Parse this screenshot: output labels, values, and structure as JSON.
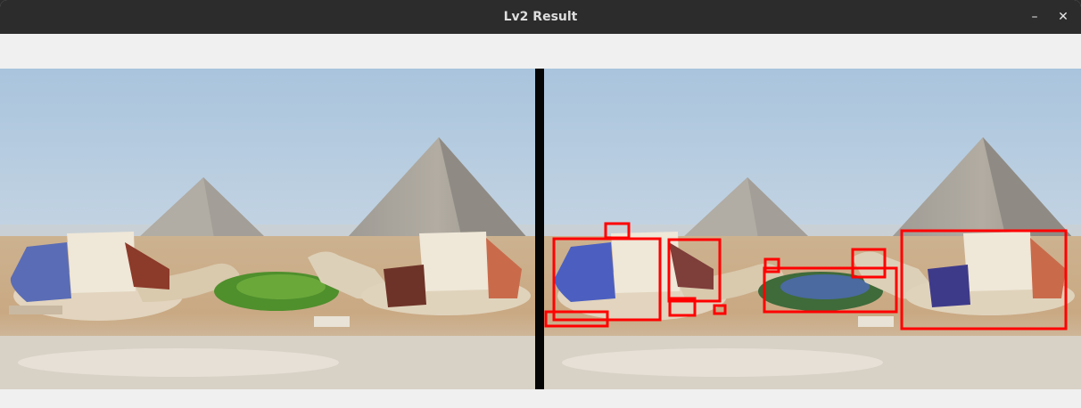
{
  "window": {
    "title": "Lv2 Result",
    "minimize_glyph": "–",
    "close_glyph": "✕"
  },
  "panels": {
    "left": {
      "kind": "original-image"
    },
    "right": {
      "kind": "result-image-with-detections"
    }
  },
  "colors": {
    "titlebar": "#2c2c2c",
    "title_text": "#dedede",
    "window_bg": "#f0f0f0",
    "divider": "#050505",
    "detection_box": "#ff0000",
    "keypoint_mark": "#2a2aa8"
  },
  "detections": {
    "count": 11
  }
}
